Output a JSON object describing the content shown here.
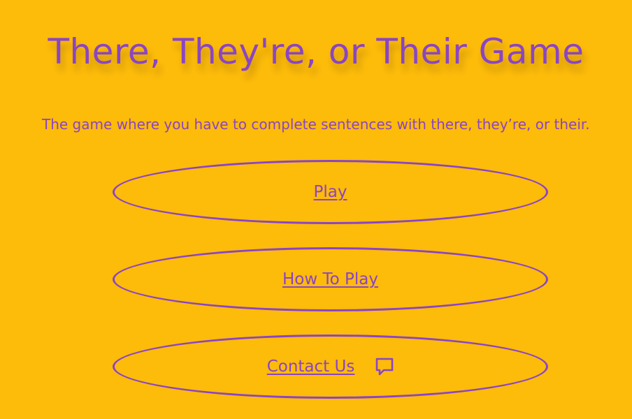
{
  "header": {
    "title": "There, They're, or Their Game",
    "subtitle": "The game where you have to complete sentences with there, they’re, or their."
  },
  "menu": {
    "play_label": "Play",
    "how_to_play_label": "How To Play",
    "contact_label": "Contact Us",
    "contact_icon": "comment-icon"
  },
  "colors": {
    "background": "#FDBB0A",
    "accent": "#8A45C4"
  }
}
